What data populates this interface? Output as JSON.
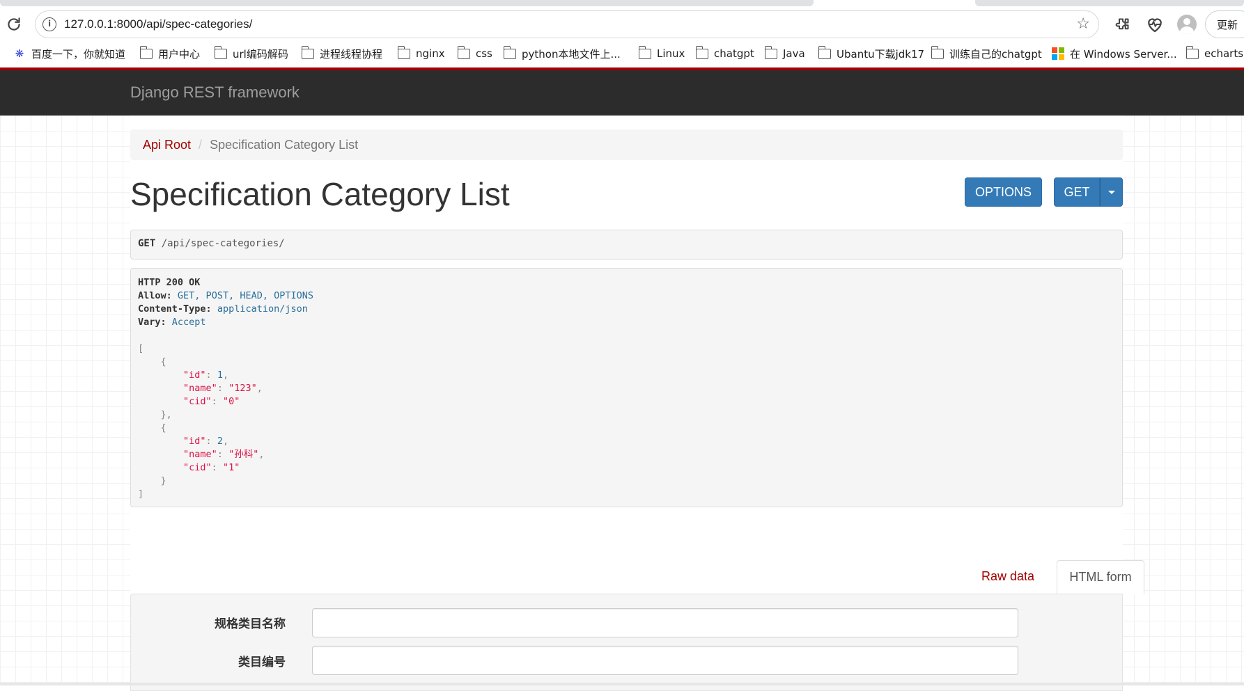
{
  "browser": {
    "url": "127.0.0.1:8000/api/spec-categories/",
    "update_label": "更新",
    "bookmarks": [
      {
        "label": "百度一下，你就知道",
        "icon": "baidu-paw-icon"
      },
      {
        "label": "用户中心",
        "icon": "folder-icon"
      },
      {
        "label": "url编码解码",
        "icon": "folder-icon"
      },
      {
        "label": "进程线程协程",
        "icon": "folder-icon"
      },
      {
        "label": "nginx",
        "icon": "folder-icon"
      },
      {
        "label": "css",
        "icon": "folder-icon"
      },
      {
        "label": "python本地文件上...",
        "icon": "folder-icon"
      },
      {
        "label": "Linux",
        "icon": "folder-icon"
      },
      {
        "label": "chatgpt",
        "icon": "folder-icon"
      },
      {
        "label": "Java",
        "icon": "folder-icon"
      },
      {
        "label": "Ubantu下载jdk17",
        "icon": "folder-icon"
      },
      {
        "label": "训练自己的chatgpt",
        "icon": "folder-icon"
      },
      {
        "label": "在 Windows Server...",
        "icon": "microsoft-logo-icon"
      },
      {
        "label": "echarts",
        "icon": "folder-icon"
      }
    ]
  },
  "navbar": {
    "brand": "Django REST framework"
  },
  "breadcrumb": {
    "root": "Api Root",
    "separator": "/",
    "current": "Specification Category List"
  },
  "page_title": "Specification Category List",
  "buttons": {
    "options": "OPTIONS",
    "get": "GET"
  },
  "request": {
    "method": "GET",
    "path": " /api/spec-categories/"
  },
  "response": {
    "status": "HTTP 200 OK",
    "headers": [
      {
        "key": "Allow:",
        "value": "GET, POST, HEAD, OPTIONS"
      },
      {
        "key": "Content-Type:",
        "value": "application/json"
      },
      {
        "key": "Vary:",
        "value": "Accept"
      }
    ],
    "items": [
      {
        "id": "1",
        "name": "\"123\"",
        "cid": "\"0\""
      },
      {
        "id": "2",
        "name": "\"孙科\"",
        "cid": "\"1\""
      }
    ]
  },
  "tabs": {
    "raw": "Raw data",
    "html": "HTML form"
  },
  "form": {
    "fields": [
      {
        "label": "规格类目名称",
        "value": ""
      },
      {
        "label": "类目编号",
        "value": ""
      }
    ]
  },
  "colors": {
    "accent": "#a30000",
    "primary_button": "#337ab7",
    "navbar": "#2c2c2c"
  }
}
